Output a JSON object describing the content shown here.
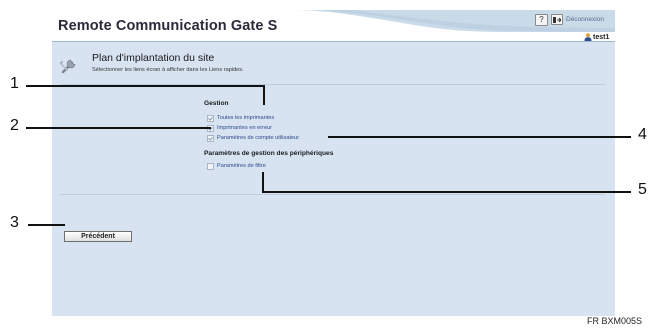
{
  "header": {
    "app_title": "Remote Communication Gate S",
    "help_label": "?",
    "logout_label": "Déconnexion",
    "user_name": "test1"
  },
  "page": {
    "title": "Plan d'implantation du site",
    "description": "Sélectionner les liens écran à afficher dans les Liens rapides."
  },
  "sections": {
    "gestion": {
      "title": "Gestion",
      "options": [
        {
          "label": "Toutes les imprimantes",
          "checked": true
        },
        {
          "label": "Imprimantes en erreur",
          "checked": true
        },
        {
          "label": "Paramètres de compte utilisateur",
          "checked": true
        }
      ]
    },
    "peripheriques": {
      "title": "Paramètres de gestion des périphériques",
      "options": [
        {
          "label": "Paramètres de filtre",
          "checked": false
        }
      ]
    }
  },
  "buttons": {
    "back_label": "Précédent"
  },
  "callouts": [
    "1",
    "2",
    "3",
    "4",
    "5"
  ],
  "figure_id": "FR BXM005S",
  "colors": {
    "panel_bg": "#d8e3f1",
    "link": "#2b4a8a",
    "header_wave": "#c9dae9"
  },
  "icons": [
    "help-icon",
    "logout-icon",
    "user-icon",
    "wrench-icon",
    "checkbox-icon"
  ]
}
